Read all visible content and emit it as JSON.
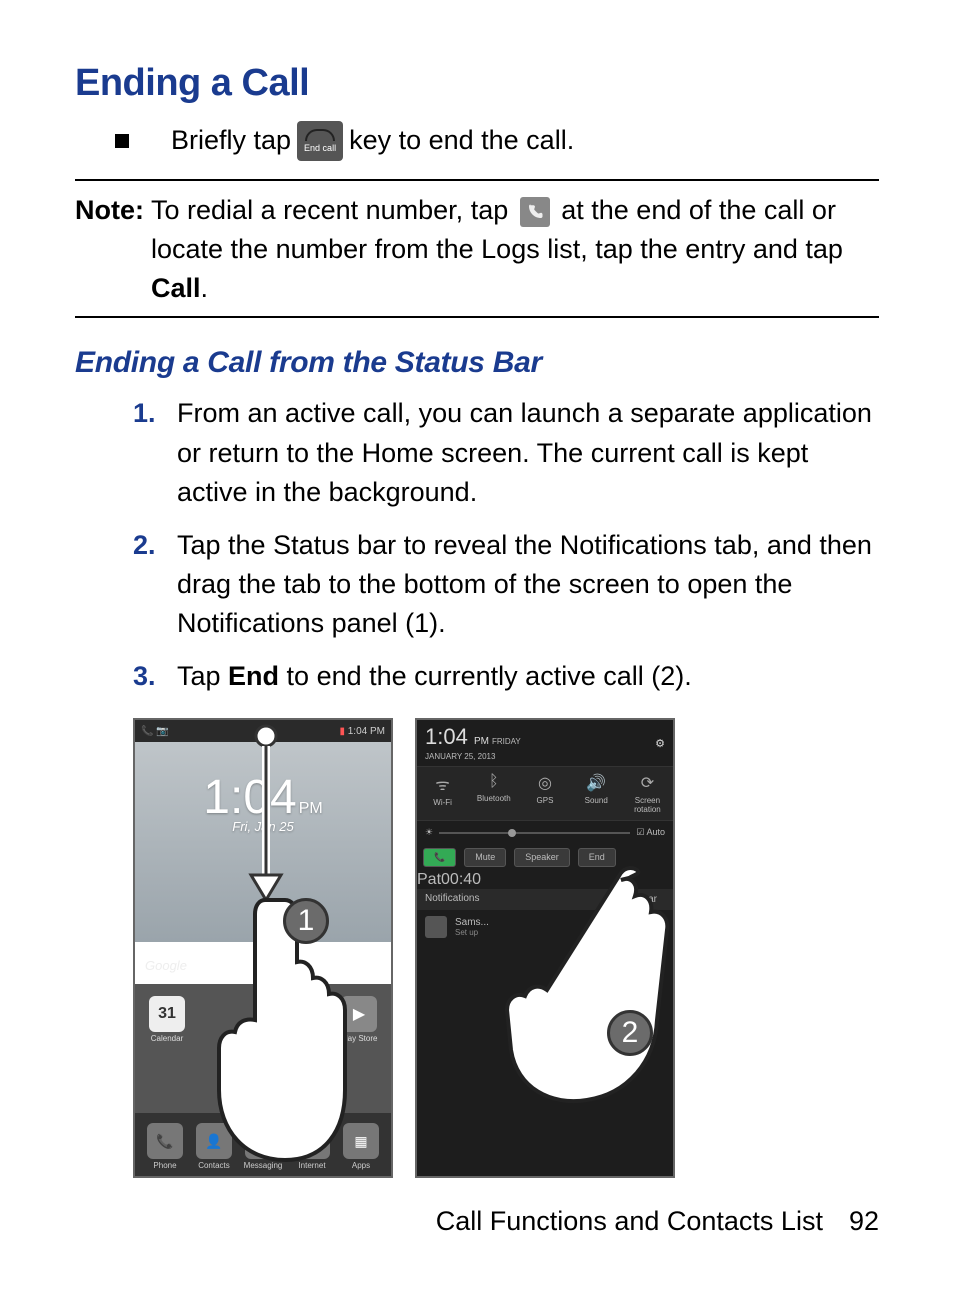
{
  "heading": "Ending a Call",
  "bullet": {
    "before": "Briefly tap",
    "icon_label": "End call",
    "after": " key to end the call."
  },
  "note": {
    "label": "Note:",
    "line1_before": " To redial a recent number, tap ",
    "line1_after": " at the end of the call or",
    "line2_before": "locate the number from the Logs list, tap the entry and tap ",
    "call_bold": "Call",
    "line2_after": "."
  },
  "subheading": "Ending a Call from the Status Bar",
  "steps": [
    {
      "num": "1.",
      "text": "From an active call, you can launch a separate application or return to the Home screen. The current call is kept active in the background."
    },
    {
      "num": "2.",
      "text": "Tap the Status bar to reveal the Notifications tab, and then drag the tab to the bottom of the screen to open the Notifications panel (1)."
    },
    {
      "num": "3.",
      "before": "Tap ",
      "bold": "End",
      "after": " to end the currently active call (2)."
    }
  ],
  "screen1": {
    "status_time": "1:04 PM",
    "clock": "1:04",
    "pm": "PM",
    "date": "Fri, Jan 25",
    "search": "Google",
    "calendar_day": "31",
    "row_labels": [
      "Calendar",
      "",
      "",
      "",
      "Play Store"
    ],
    "dock": [
      {
        "name": "Phone"
      },
      {
        "name": "Contacts"
      },
      {
        "name": "Messaging"
      },
      {
        "name": "Internet"
      },
      {
        "name": "Apps"
      }
    ],
    "callout": "1"
  },
  "screen2": {
    "time": "1:04",
    "pm": "PM",
    "day": "FRIDAY",
    "date": "JANUARY 25, 2013",
    "toggles": [
      {
        "label": "Wi-Fi",
        "icon": "wifi"
      },
      {
        "label": "Bluetooth",
        "icon": "bluetooth"
      },
      {
        "label": "GPS",
        "icon": "gps"
      },
      {
        "label": "Sound",
        "icon": "sound"
      },
      {
        "label": "Screen rotation",
        "icon": "rotate"
      }
    ],
    "auto": "Auto",
    "call_buttons": [
      "Mute",
      "Speaker",
      "End"
    ],
    "caller": "Pat",
    "duration": "00:40",
    "notif_header": "Notifications",
    "clear": "Clear",
    "notif_item_title": "Sams...",
    "notif_item_sub": "Set up",
    "callout": "2"
  },
  "footer": {
    "section": "Call Functions and Contacts List",
    "page": "92"
  }
}
